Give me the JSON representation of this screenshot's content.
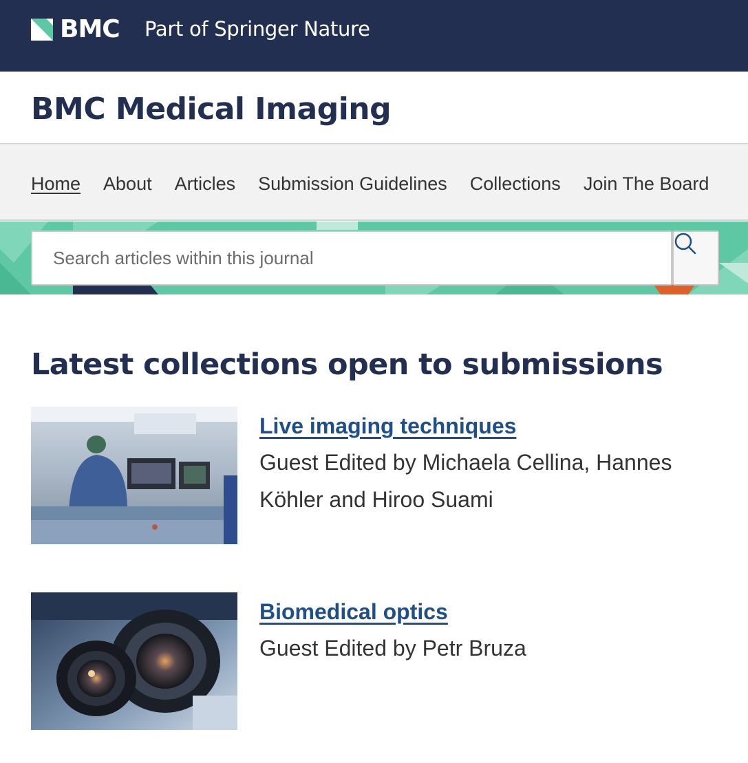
{
  "brand": {
    "wordmark": "BMC",
    "tagline": "Part of Springer Nature"
  },
  "journal": {
    "title": "BMC Medical Imaging"
  },
  "nav": {
    "items": [
      {
        "label": "Home",
        "active": true
      },
      {
        "label": "About"
      },
      {
        "label": "Articles"
      },
      {
        "label": "Submission Guidelines"
      },
      {
        "label": "Collections"
      },
      {
        "label": "Join The Board"
      }
    ]
  },
  "search": {
    "placeholder": "Search articles within this journal",
    "value": ""
  },
  "collections": {
    "heading": "Latest collections open to submissions",
    "items": [
      {
        "title": "Live imaging techniques",
        "editors": "Guest Edited by Michaela Cellina, Hannes Köhler and Hiroo Suami"
      },
      {
        "title": "Biomedical optics",
        "editors": "Guest Edited by Petr Bruza"
      }
    ]
  },
  "colors": {
    "header_navy": "#222f51",
    "brand_green": "#5ec8a4",
    "link_blue": "#1f4f8a",
    "nav_bg": "#f2f2f2"
  },
  "icons": {
    "search": "search-icon",
    "logo": "bmc-logo-icon"
  }
}
